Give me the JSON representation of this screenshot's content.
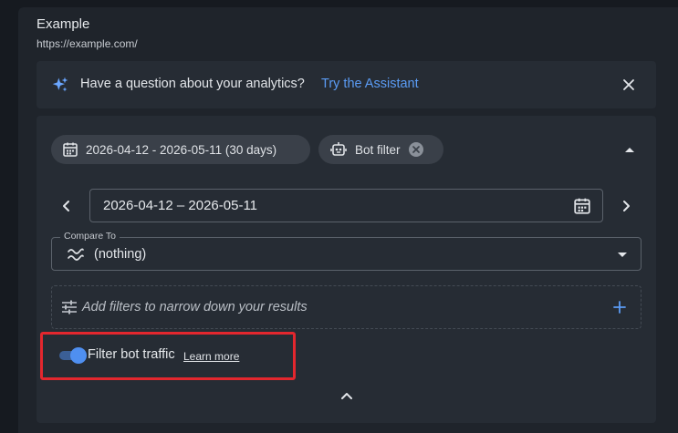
{
  "site": {
    "name": "Example",
    "url": "https://example.com/"
  },
  "assistant": {
    "question": "Have a question about your analytics?",
    "link_label": "Try the Assistant",
    "icon": "sparkle-icon",
    "accent": "#5b9cf5"
  },
  "chips": {
    "date_range": "2026-04-12 - 2026-05-11 (30 days)",
    "bot_filter": "Bot filter"
  },
  "date_picker": {
    "value": "2026-04-12 – 2026-05-11"
  },
  "compare": {
    "label": "Compare To",
    "value": "(nothing)"
  },
  "filters": {
    "placeholder": "Add filters to narrow down your results"
  },
  "bot_toggle": {
    "label": "Filter bot traffic",
    "learn_more": "Learn more",
    "enabled": true,
    "color": "#4f8ff0"
  },
  "colors": {
    "highlight": "#e3272e",
    "background": "#161a20",
    "card": "#262c34"
  }
}
